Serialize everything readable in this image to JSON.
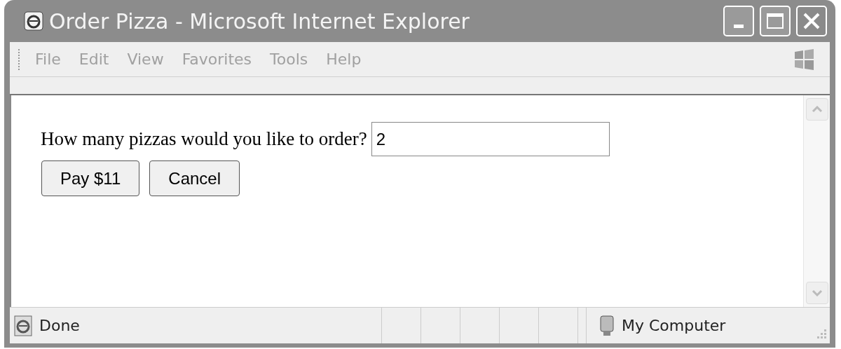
{
  "window": {
    "title": "Order Pizza - Microsoft Internet Explorer"
  },
  "menu": [
    "File",
    "Edit",
    "View",
    "Favorites",
    "Tools",
    "Help"
  ],
  "form": {
    "question": "How many pizzas would you like to order?",
    "quantity": "2",
    "buttons": [
      "Pay $11",
      "Cancel"
    ]
  },
  "status_bar": {
    "text": "Done",
    "zone": "My Computer"
  }
}
